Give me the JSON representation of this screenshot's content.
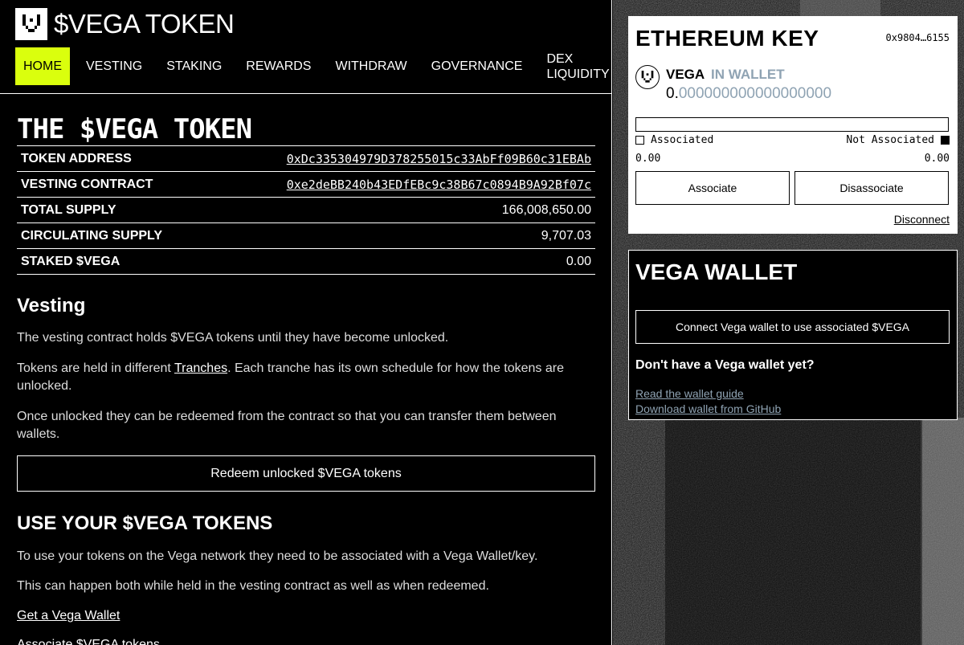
{
  "brand": {
    "title": "$VEGA TOKEN"
  },
  "nav": {
    "items": [
      {
        "label": "HOME"
      },
      {
        "label": "VESTING"
      },
      {
        "label": "STAKING"
      },
      {
        "label": "REWARDS"
      },
      {
        "label": "WITHDRAW"
      },
      {
        "label": "GOVERNANCE"
      },
      {
        "label_line1": "DEX",
        "label_line2": "LIQUIDITY"
      }
    ],
    "active_color": "#daff0d"
  },
  "main": {
    "title": "THE $VEGA TOKEN",
    "info_rows": [
      {
        "key": "TOKEN ADDRESS",
        "value": "0xDc335304979D378255015c33AbFf09B60c31EBAb"
      },
      {
        "key": "VESTING CONTRACT",
        "value": "0xe2deBB240b43EDfEBc9c38B67c0894B9A92Bf07c"
      },
      {
        "key": "TOTAL SUPPLY",
        "value": "166,008,650.00"
      },
      {
        "key": "CIRCULATING SUPPLY",
        "value": "9,707.03"
      },
      {
        "key": "STAKED $VEGA",
        "value": "0.00"
      }
    ],
    "vesting": {
      "heading": "Vesting",
      "p1": "The vesting contract holds $VEGA tokens until they have become unlocked.",
      "p2_before": "Tokens are held in different ",
      "p2_link": "Tranches",
      "p2_after": ". Each tranche has its own schedule for how the tokens are unlocked.",
      "p3": "Once unlocked they can be redeemed from the contract so that you can transfer them between wallets.",
      "redeem_button": "Redeem unlocked $VEGA tokens"
    },
    "use": {
      "heading": "USE YOUR $VEGA TOKENS",
      "p1": "To use your tokens on the Vega network they need to be associated with a Vega Wallet/key.",
      "p2": "This can happen both while held in the vesting contract as well as when redeemed.",
      "link1": "Get a Vega Wallet",
      "link2": "Associate $VEGA tokens"
    }
  },
  "eth_card": {
    "title": "ETHEREUM KEY",
    "address": "0x9804…6155",
    "token": "VEGA",
    "in_wallet": "IN WALLET",
    "balance_int": "0.",
    "balance_dec": "000000000000000000",
    "associated_fraction": 0,
    "associated_label": "Associated",
    "not_associated_label": "Not Associated",
    "associated_value": "0.00",
    "not_associated_value": "0.00",
    "associate_button": "Associate",
    "disassociate_button": "Disassociate",
    "disconnect_link": "Disconnect"
  },
  "vega_wallet": {
    "title": "VEGA WALLET",
    "connect_button": "Connect Vega wallet to use associated $VEGA",
    "question": "Don't have a Vega wallet yet?",
    "guide_link": "Read the wallet guide",
    "download_link": "Download wallet from GitHub"
  },
  "icons": {
    "logo": "vega-logo-icon",
    "checkbox": "checkbox-icon"
  },
  "colors": {
    "accent": "#daff0d",
    "muted": "#8fa3b3"
  }
}
